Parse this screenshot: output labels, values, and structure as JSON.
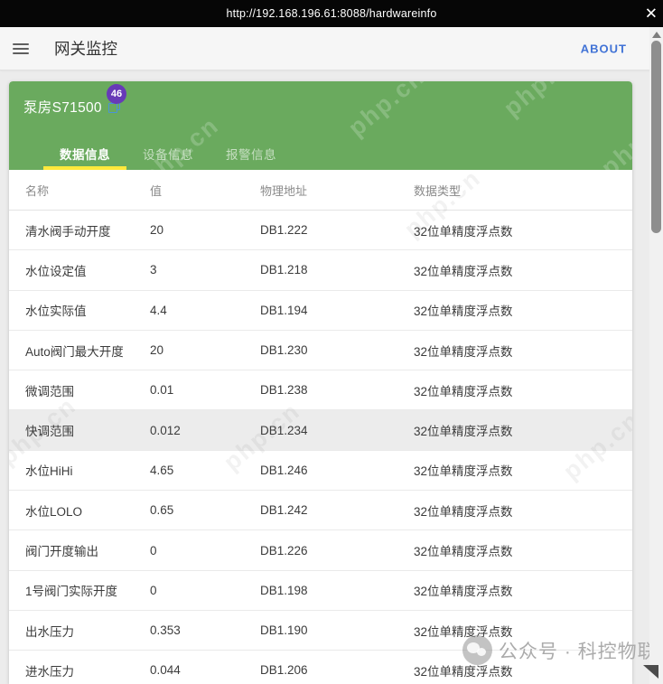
{
  "browser": {
    "url": "http://192.168.196.61:8088/hardwareinfo",
    "close_icon": "✕"
  },
  "header": {
    "title": "网关监控",
    "about": "ABOUT"
  },
  "panel": {
    "device": "泵房S71500",
    "badge": "46",
    "tabs": [
      {
        "label": "数据信息",
        "active": true
      },
      {
        "label": "设备信息",
        "active": false
      },
      {
        "label": "报警信息",
        "active": false
      }
    ]
  },
  "table": {
    "columns": [
      "名称",
      "值",
      "物理地址",
      "数据类型"
    ],
    "rows": [
      {
        "name": "清水阀手动开度",
        "value": "20",
        "address": "DB1.222",
        "type": "32位单精度浮点数",
        "highlighted": false
      },
      {
        "name": "水位设定值",
        "value": "3",
        "address": "DB1.218",
        "type": "32位单精度浮点数",
        "highlighted": false
      },
      {
        "name": "水位实际值",
        "value": "4.4",
        "address": "DB1.194",
        "type": "32位单精度浮点数",
        "highlighted": false
      },
      {
        "name": "Auto阀门最大开度",
        "value": "20",
        "address": "DB1.230",
        "type": "32位单精度浮点数",
        "highlighted": false
      },
      {
        "name": "微调范围",
        "value": "0.01",
        "address": "DB1.238",
        "type": "32位单精度浮点数",
        "highlighted": false
      },
      {
        "name": "快调范围",
        "value": "0.012",
        "address": "DB1.234",
        "type": "32位单精度浮点数",
        "highlighted": true
      },
      {
        "name": "水位HiHi",
        "value": "4.65",
        "address": "DB1.246",
        "type": "32位单精度浮点数",
        "highlighted": false
      },
      {
        "name": "水位LOLO",
        "value": "0.65",
        "address": "DB1.242",
        "type": "32位单精度浮点数",
        "highlighted": false
      },
      {
        "name": "阀门开度输出",
        "value": "0",
        "address": "DB1.226",
        "type": "32位单精度浮点数",
        "highlighted": false
      },
      {
        "name": "1号阀门实际开度",
        "value": "0",
        "address": "DB1.198",
        "type": "32位单精度浮点数",
        "highlighted": false
      },
      {
        "name": "出水压力",
        "value": "0.353",
        "address": "DB1.190",
        "type": "32位单精度浮点数",
        "highlighted": false
      },
      {
        "name": "进水压力",
        "value": "0.044",
        "address": "DB1.206",
        "type": "32位单精度浮点数",
        "highlighted": false
      }
    ]
  },
  "watermarks": {
    "brand": "php.cn",
    "footer": "公众号 · 科控物联"
  },
  "colors": {
    "accent_green": "#6aaa5e",
    "badge_purple": "#673ab7",
    "tab_underline_yellow": "#ffe93b",
    "about_blue": "#4173d6",
    "row_highlight": "#ececec",
    "urlbar_black": "#060606"
  }
}
